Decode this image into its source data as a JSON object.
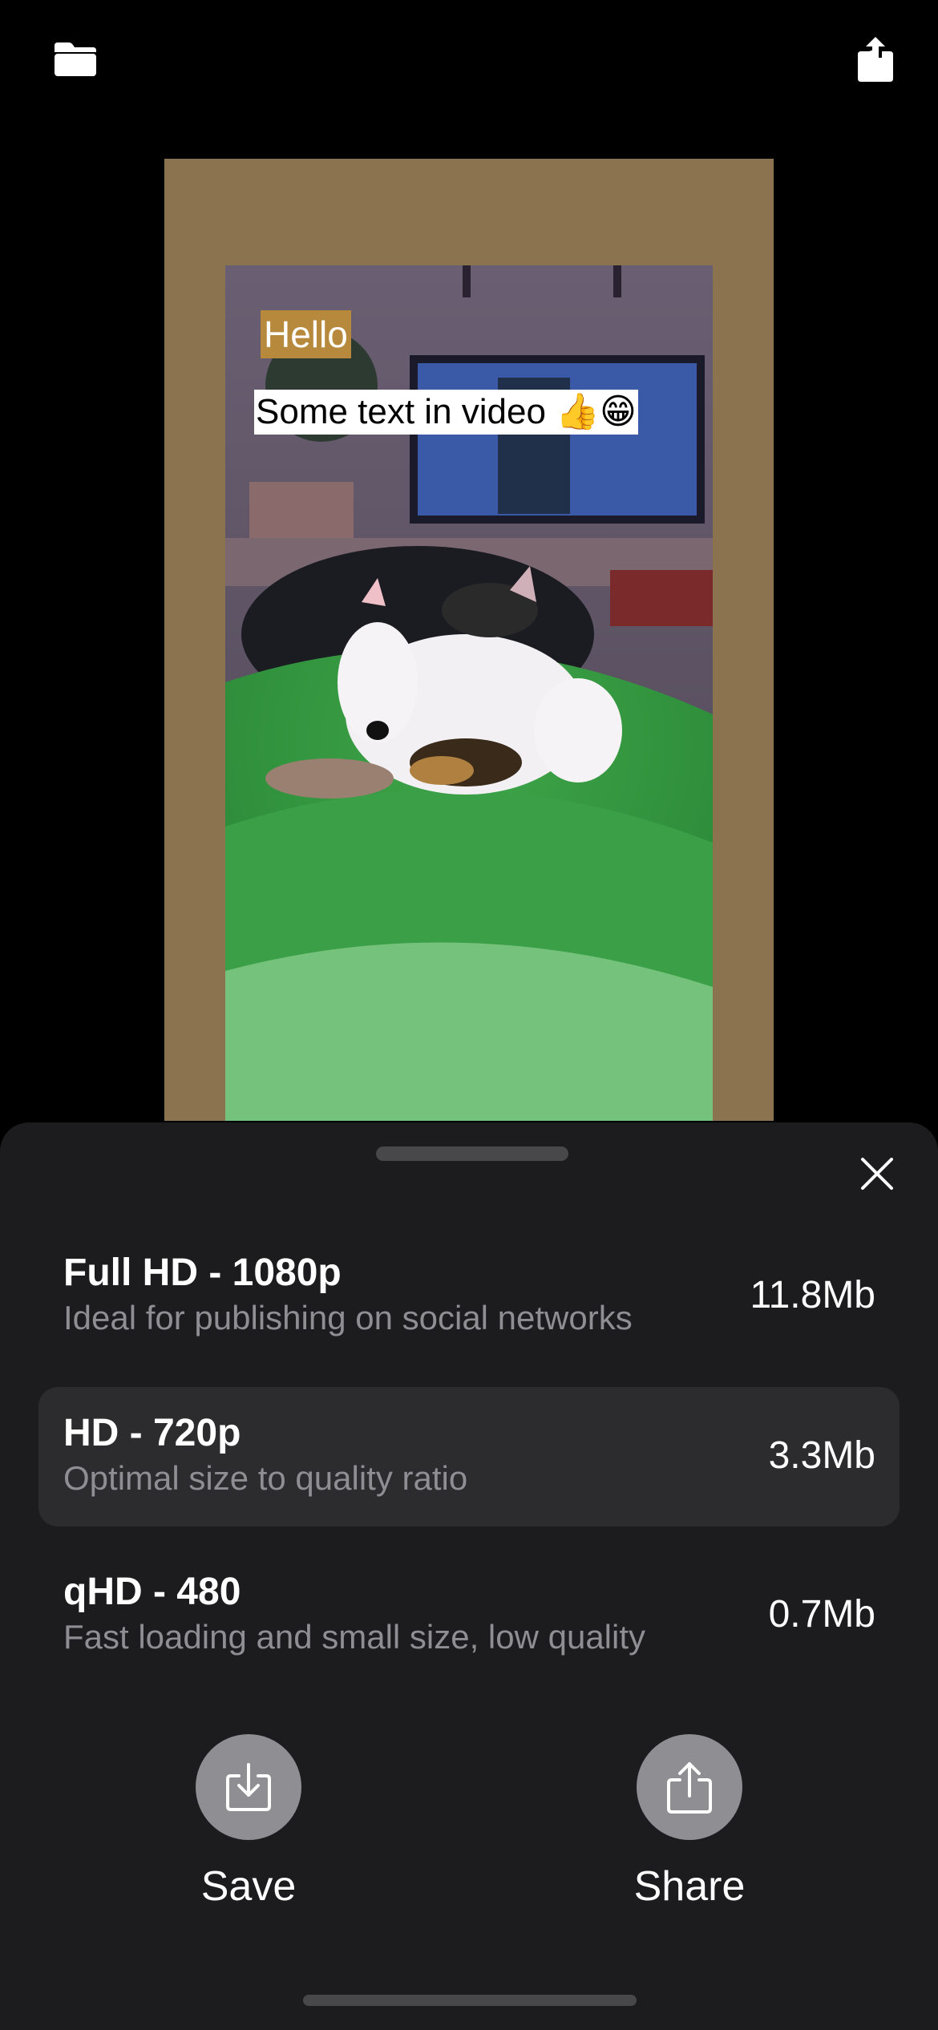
{
  "toolbar": {
    "folder_icon": "folder-icon",
    "export_icon": "share-up-icon"
  },
  "video": {
    "overlay_hello": "Hello",
    "overlay_caption": "Some text in video 👍😁",
    "canvas_color": "#8c7350"
  },
  "sheet": {
    "close_icon": "close-icon",
    "options": [
      {
        "title": "Full HD - 1080p",
        "subtitle": "Ideal for publishing on social networks",
        "size": "11.8Mb",
        "selected": false
      },
      {
        "title": "HD - 720p",
        "subtitle": "Optimal size to quality ratio",
        "size": "3.3Mb",
        "selected": true
      },
      {
        "title": "qHD - 480",
        "subtitle": "Fast loading and small size, low quality",
        "size": "0.7Mb",
        "selected": false
      }
    ],
    "actions": {
      "save_label": "Save",
      "share_label": "Share"
    }
  },
  "colors": {
    "sheet_bg": "#1c1c1e",
    "selected_row_bg": "#2c2c2e",
    "secondary_text": "#8e8e93"
  }
}
